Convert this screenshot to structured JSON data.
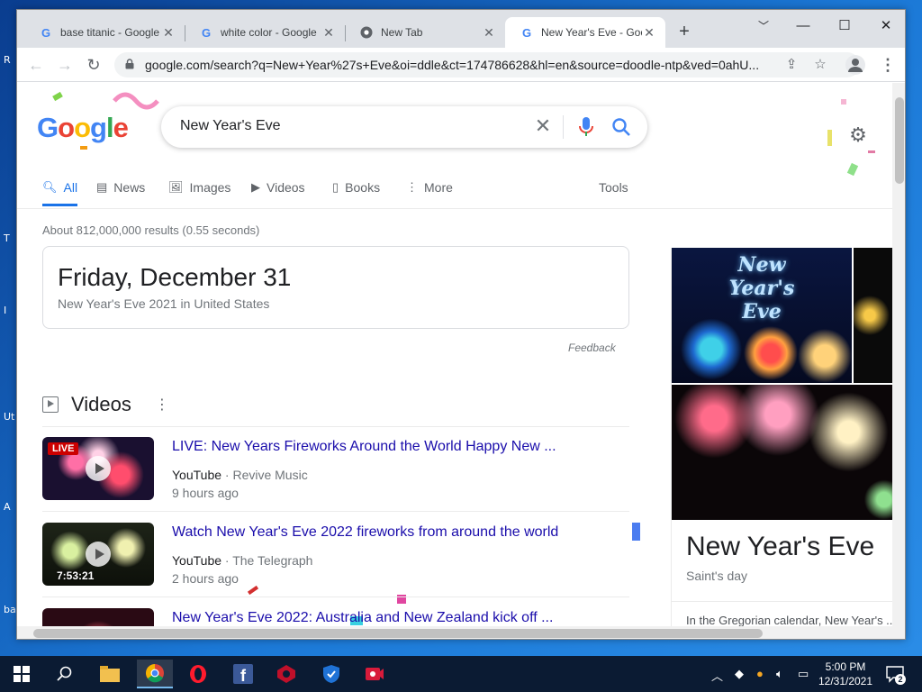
{
  "desktop": {
    "edge_labels": [
      "R",
      "T",
      "I",
      "Ut",
      "A",
      "ba"
    ]
  },
  "tabs": [
    {
      "title": "base titanic - Google",
      "favicon": "google-g-icon"
    },
    {
      "title": "white color - Google",
      "favicon": "google-g-icon"
    },
    {
      "title": "New Tab",
      "favicon": "chrome-icon"
    },
    {
      "title": "New Year's Eve - Goo",
      "favicon": "google-g-icon",
      "active": true
    }
  ],
  "toolbar": {
    "url": "google.com/search?q=New+Year%27s+Eve&oi=ddle&ct=174786628&hl=en&source=doodle-ntp&ved=0ahU..."
  },
  "search": {
    "query": "New Year's Eve",
    "logo_text": "Google"
  },
  "nav_tabs": {
    "all": "All",
    "news": "News",
    "images": "Images",
    "videos": "Videos",
    "books": "Books",
    "more": "More",
    "tools": "Tools"
  },
  "results": {
    "stats": "About 812,000,000 results (0.55 seconds)",
    "date_card": {
      "headline": "Friday, December 31",
      "subtitle": "New Year's Eve 2021 in United States"
    },
    "feedback": "Feedback",
    "videos_heading": "Videos",
    "videos": [
      {
        "title": "LIVE: New Years Fireworks Around the World Happy New ...",
        "source": "YouTube",
        "channel": "· Revive Music",
        "time": "9 hours ago",
        "badge": "LIVE"
      },
      {
        "title": "Watch New Year's Eve 2022 fireworks from around the world",
        "source": "YouTube",
        "channel": "· The Telegraph",
        "time": "2 hours ago",
        "duration": "7:53:21"
      },
      {
        "title": "New Year's Eve 2022: Australia and New Zealand kick off ..."
      }
    ]
  },
  "knowledge_panel": {
    "image_text": "New Year's Eve",
    "title": "New Year's Eve",
    "subtitle": "Saint's day",
    "description": "In the Gregorian calendar, New Year's ..."
  },
  "taskbar": {
    "time": "5:00 PM",
    "date": "12/31/2021",
    "notification_count": "2"
  },
  "colors": {
    "link": "#1a0dab",
    "accent": "#1a73e8",
    "taskbar": "#0b1b33"
  }
}
